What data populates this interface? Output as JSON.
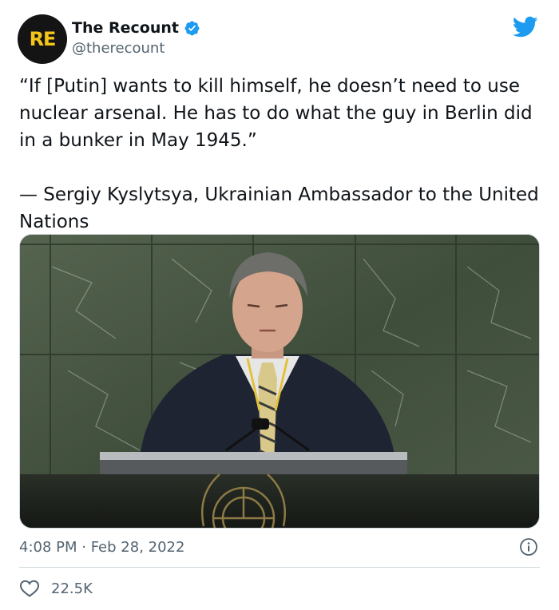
{
  "author": {
    "avatar_text": "RE",
    "display_name": "The Recount",
    "handle": "@therecount",
    "verified": true
  },
  "tweet": {
    "text": "“If [Putin] wants to kill himself, he doesn’t need to use nuclear arsenal. He has to do what the guy in Berlin did in a bunker in May 1945.”\n\n— Sergiy Kyslytsya, Ukrainian Ambassador to the United Nations",
    "timestamp": "4:08 PM · Feb 28, 2022",
    "likes": "22.5K"
  },
  "media": {
    "type": "photo"
  },
  "icons": {
    "platform": "twitter-bird-icon",
    "verified": "verified-badge-icon",
    "info": "info-icon",
    "like": "heart-icon"
  },
  "colors": {
    "twitter_blue": "#1d9bf0",
    "text_primary": "#0f1419",
    "text_secondary": "#536471",
    "avatar_bg": "#141414",
    "avatar_fg": "#f5c518"
  }
}
